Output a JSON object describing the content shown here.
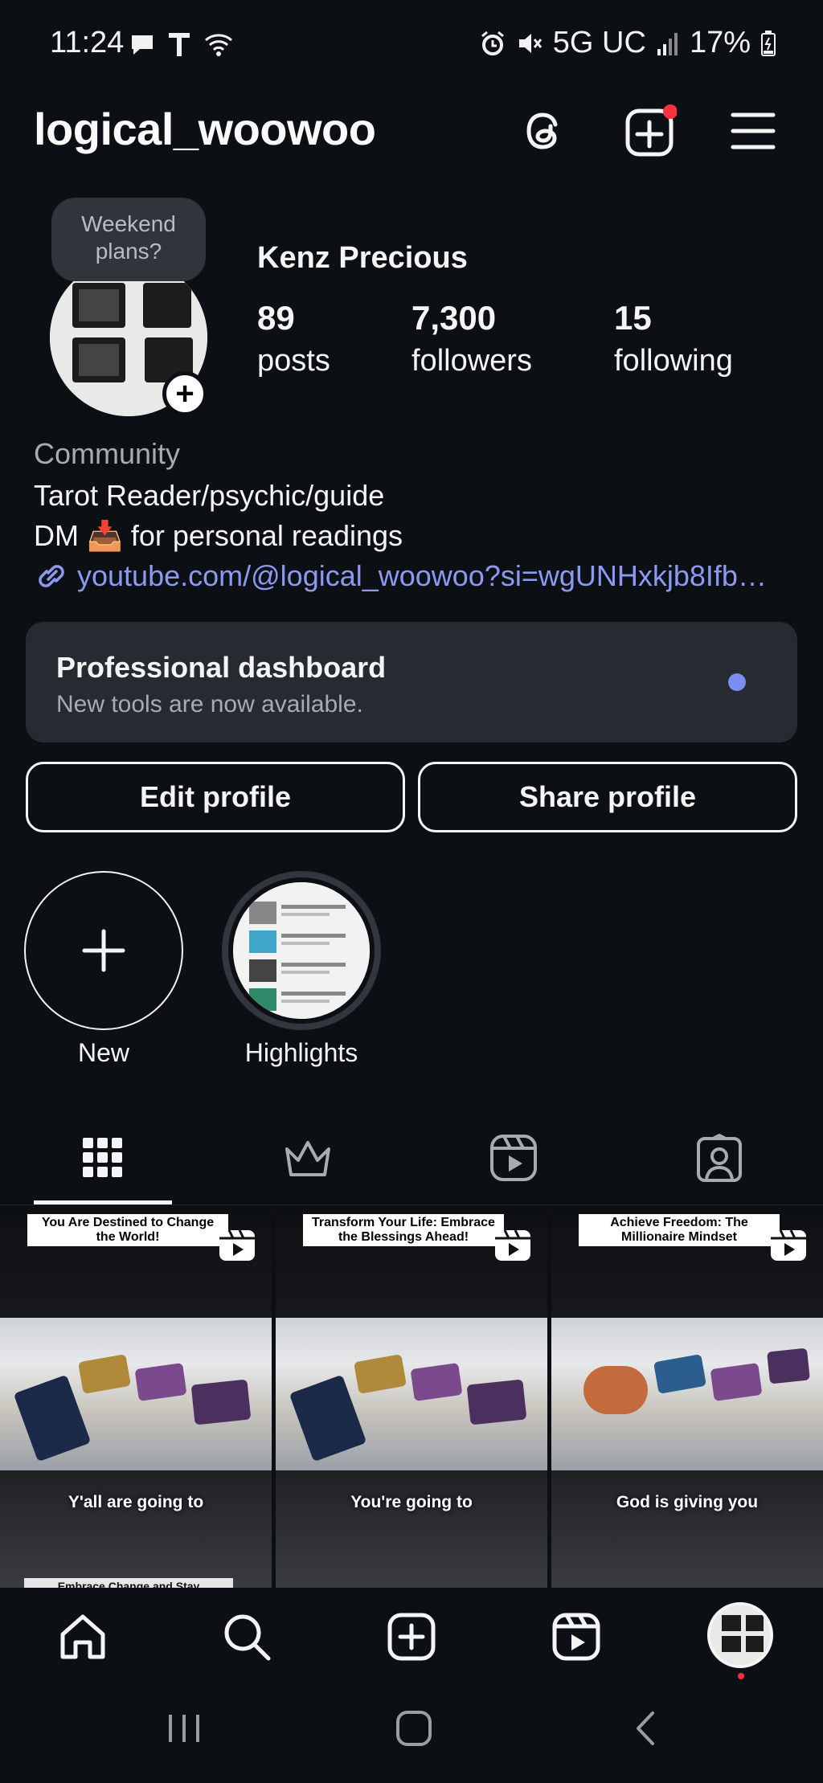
{
  "status_bar": {
    "time": "11:24",
    "network": "5G UC",
    "battery": "17%",
    "icons": [
      "chat-bubble-icon",
      "t-mobile-icon",
      "wifi-call-icon",
      "alarm-icon",
      "mute-icon",
      "signal-icon",
      "battery-icon"
    ]
  },
  "header": {
    "username": "logical_woowoo",
    "icons": [
      "threads-icon",
      "create-icon",
      "menu-icon"
    ],
    "notification_color": "#ff3040"
  },
  "profile": {
    "note": "Weekend plans?",
    "display_name": "Kenz Precious",
    "stats": [
      {
        "value": "89",
        "label": "posts"
      },
      {
        "value": "7,300",
        "label": "followers"
      },
      {
        "value": "15",
        "label": "following"
      }
    ],
    "category": "Community",
    "bio_lines": [
      "Tarot Reader/psychic/guide",
      "DM 📥 for personal readings"
    ],
    "link": "youtube.com/@logical_woowoo?si=wgUNHxkjb8Ifb…"
  },
  "dashboard": {
    "title": "Professional dashboard",
    "subtitle": "New tools are now available.",
    "dot_color": "#7b8ff1"
  },
  "buttons": {
    "edit": "Edit profile",
    "share": "Share profile"
  },
  "highlights": [
    {
      "label": "New",
      "icon": "plus-icon"
    },
    {
      "label": "Highlights",
      "icon": "highlight-thumbnail"
    }
  ],
  "tabs": [
    "grid-icon",
    "crown-icon",
    "reels-icon",
    "tagged-icon"
  ],
  "posts": [
    {
      "title": "You Are Destined to Change the World!",
      "caption": "Y'all are going to",
      "peek": "Embrace Change and Stay"
    },
    {
      "title": "Transform Your Life: Embrace the Blessings Ahead!",
      "caption": "You're going to",
      "peek": ""
    },
    {
      "title": "Achieve Freedom: The Millionaire Mindset",
      "caption": "God is giving you",
      "peek": ""
    }
  ],
  "bottom_nav": [
    "home-icon",
    "search-icon",
    "create-icon",
    "reels-icon",
    "profile-avatar"
  ],
  "system_nav": [
    "recents-icon",
    "home-button-icon",
    "back-icon"
  ]
}
